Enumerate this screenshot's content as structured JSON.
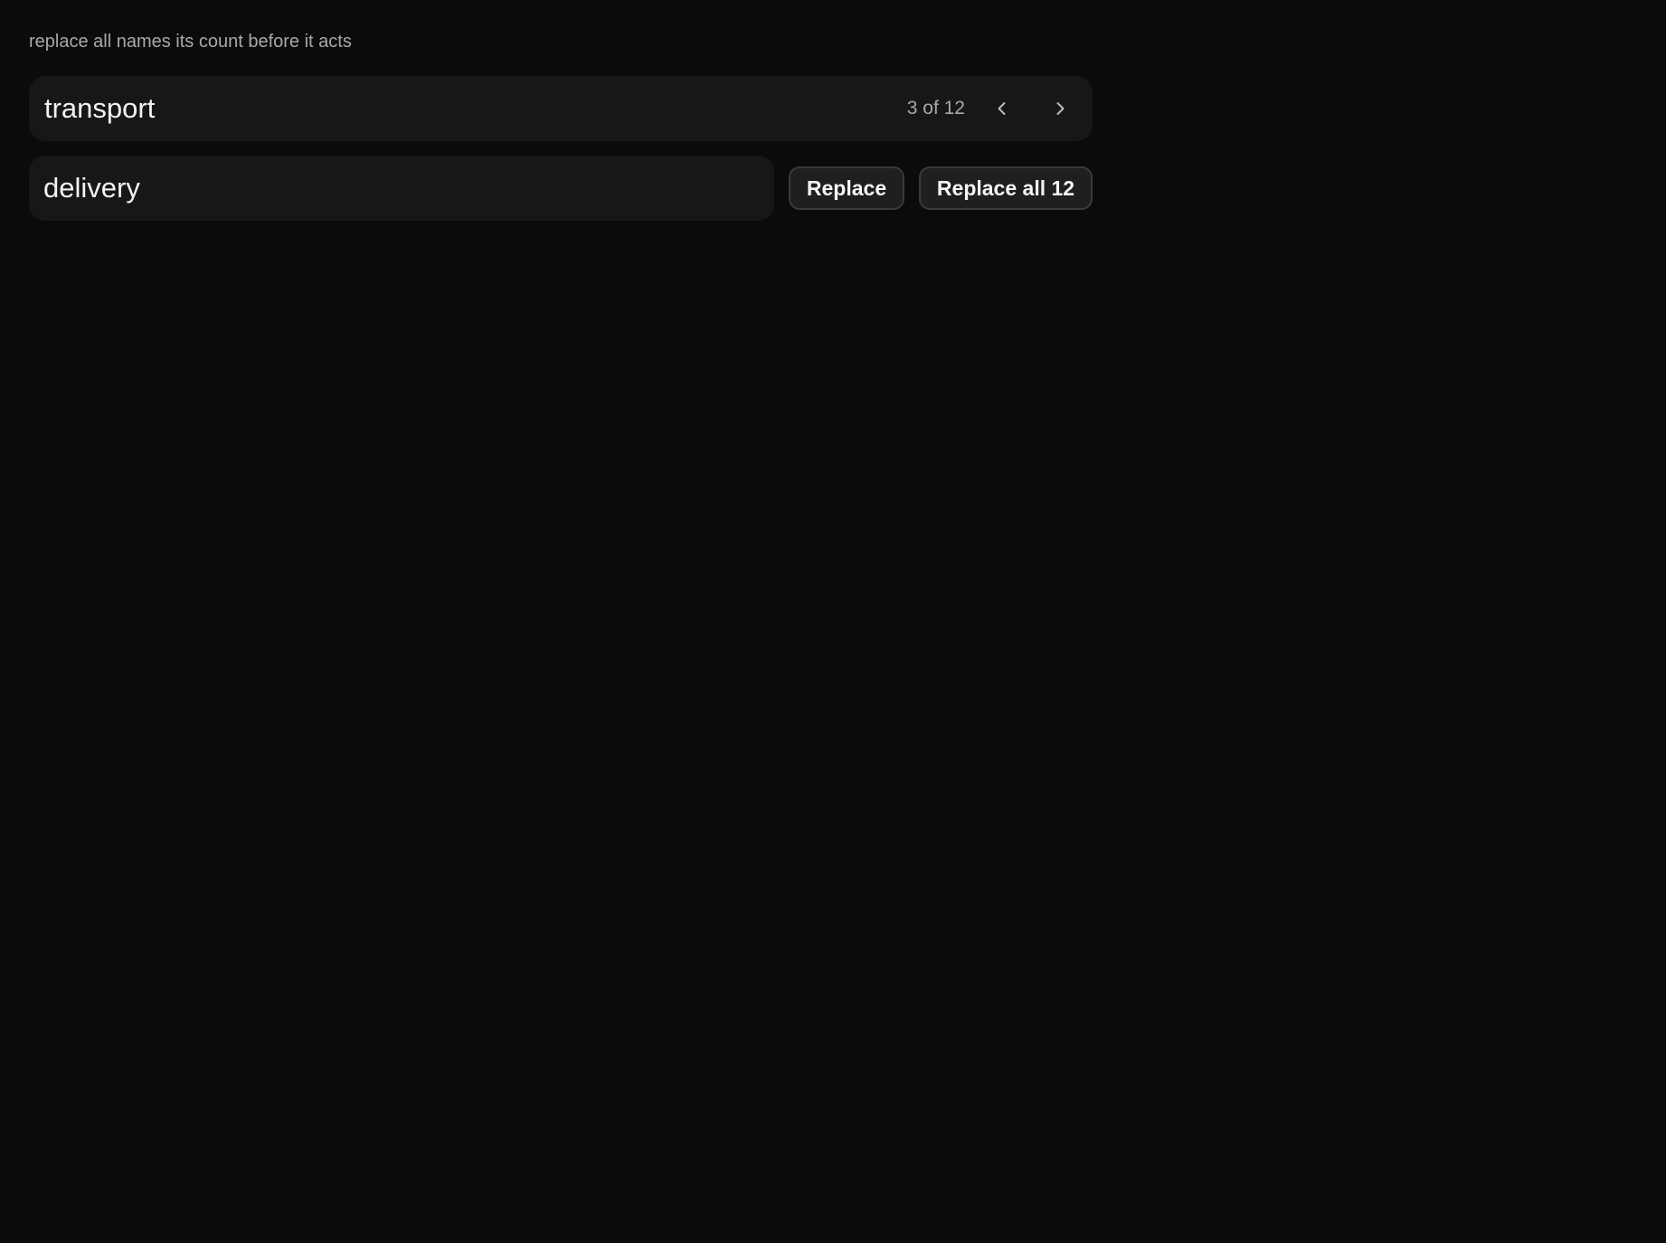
{
  "caption": "replace all names its count before it acts",
  "find": {
    "value": "transport",
    "match_count": "3 of 12",
    "prev_icon": "chevron-left-icon",
    "next_icon": "chevron-right-icon"
  },
  "replace": {
    "value": "delivery",
    "replace_label": "Replace",
    "replace_all_label": "Replace all 12"
  },
  "colors": {
    "background": "#0b0b0b",
    "field": "#171717",
    "button": "#1f1f1f",
    "button_border": "#3a3a3a",
    "muted_text": "#a9a9a9",
    "text": "#f2f2f2"
  }
}
